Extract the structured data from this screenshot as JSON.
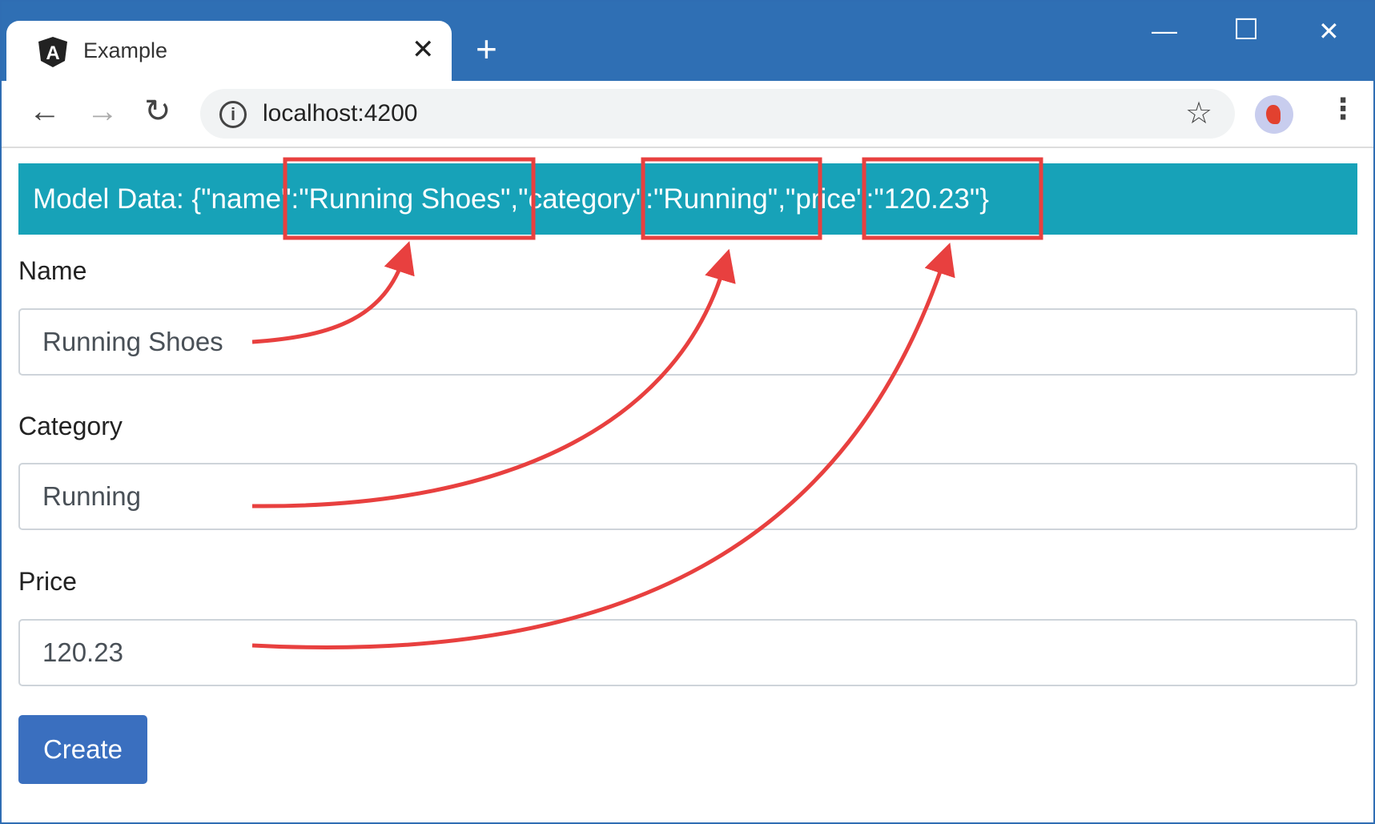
{
  "browser": {
    "tab_title": "Example",
    "tab_close": "✕",
    "new_tab": "+",
    "minimize": "—",
    "maximize": "☐",
    "close": "✕",
    "back": "←",
    "forward": "→",
    "reload": "↻",
    "info": "i",
    "url": "localhost:4200",
    "star": "☆",
    "menu": "⋮"
  },
  "page": {
    "model_data": "Model Data: {\"name\":\"Running Shoes\",\"category\":\"Running\",\"price\":\"120.23\"}",
    "fields": [
      {
        "label": "Name",
        "value": "Running Shoes"
      },
      {
        "label": "Category",
        "value": "Running"
      },
      {
        "label": "Price",
        "value": "120.23"
      }
    ],
    "create_label": "Create"
  },
  "colors": {
    "annotation": "#e8403f",
    "banner": "#17a2b8",
    "button": "#3a6fbf",
    "titlebar": "#2f6fb4"
  }
}
